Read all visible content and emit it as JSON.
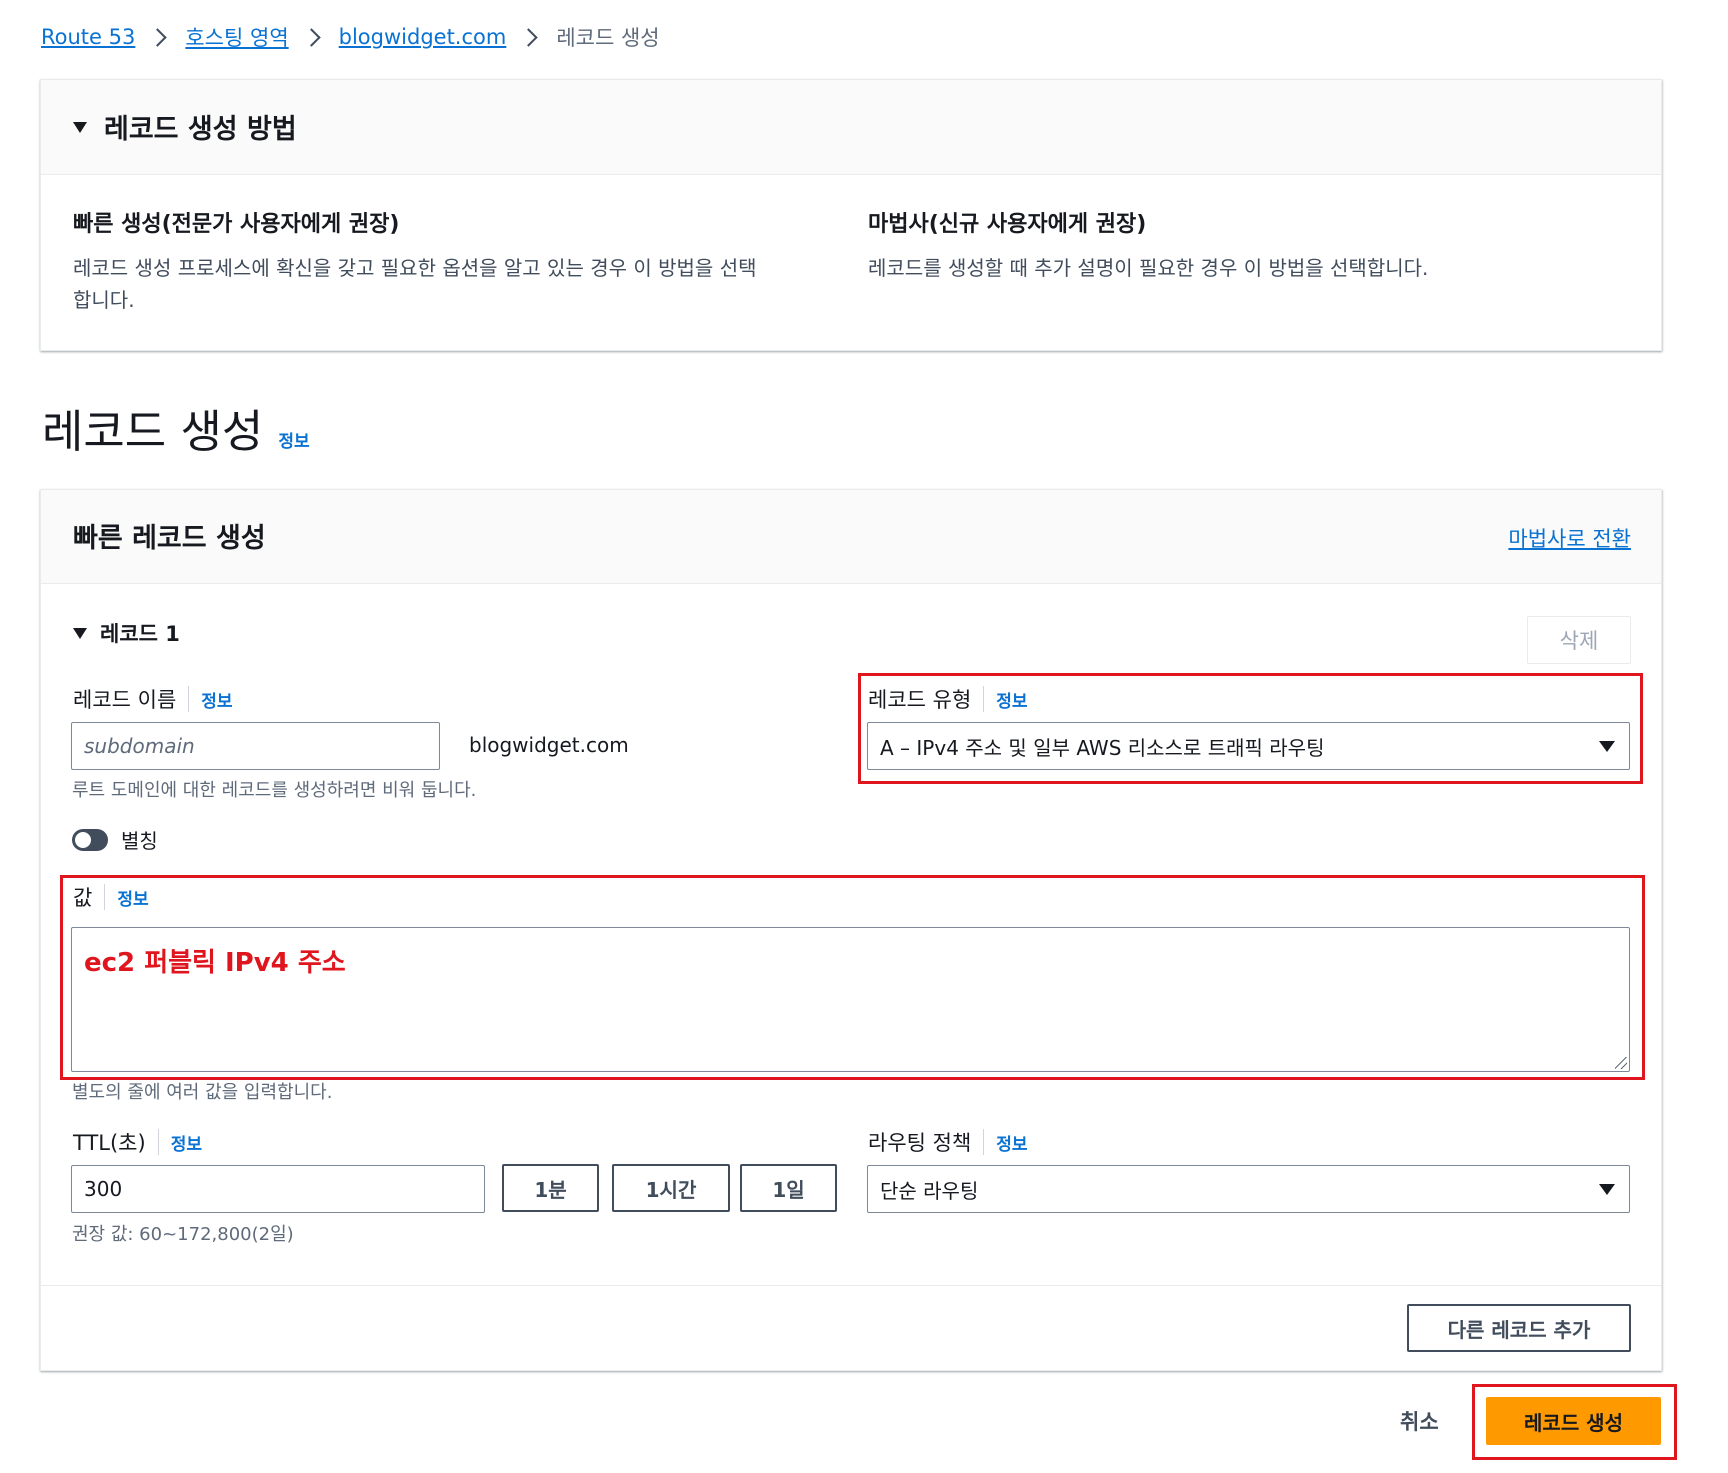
{
  "breadcrumb": {
    "items": [
      "Route 53",
      "호스팅 영역",
      "blogwidget.com"
    ],
    "current": "레코드 생성"
  },
  "method_panel": {
    "title": "레코드 생성 방법",
    "quick_title": "빠른 생성(전문가 사용자에게 권장)",
    "quick_desc_line1": "레코드 생성 프로세스에 확신을 갖고 필요한 옵션을 알고 있는 경우 이 방법을 선택",
    "quick_desc_line2": "합니다.",
    "wizard_title": "마법사(신규 사용자에게 권장)",
    "wizard_desc": "레코드를 생성할 때 추가 설명이 필요한 경우 이 방법을 선택합니다."
  },
  "page": {
    "title": "레코드 생성",
    "info": "정보"
  },
  "quick_panel": {
    "title": "빠른 레코드 생성",
    "switch_link": "마법사로 전환",
    "record_title": "레코드 1",
    "delete_button": "삭제",
    "record_name": {
      "label": "레코드 이름",
      "info": "정보",
      "placeholder": "subdomain",
      "domain_suffix": "blogwidget.com",
      "hint": "루트 도메인에 대한 레코드를 생성하려면 비워 둡니다."
    },
    "record_type": {
      "label": "레코드 유형",
      "info": "정보",
      "value": "A – IPv4 주소 및 일부 AWS 리소스로 트래픽 라우팅"
    },
    "alias": {
      "label": "별칭",
      "enabled": false
    },
    "value": {
      "label": "값",
      "info": "정보",
      "annotation": "ec2 퍼블릭 IPv4 주소",
      "hint": "별도의 줄에 여러 값을 입력합니다."
    },
    "ttl": {
      "label": "TTL(초)",
      "info": "정보",
      "value": "300",
      "presets": [
        "1분",
        "1시간",
        "1일"
      ],
      "hint": "권장 값: 60~172,800(2일)"
    },
    "routing": {
      "label": "라우팅 정책",
      "info": "정보",
      "value": "단순 라우팅"
    },
    "add_record_button": "다른 레코드 추가"
  },
  "footer": {
    "cancel": "취소",
    "submit": "레코드 생성"
  },
  "colors": {
    "link": "#0972d3",
    "primary_button": "#ff9900",
    "annotation_red": "#e0161e"
  }
}
